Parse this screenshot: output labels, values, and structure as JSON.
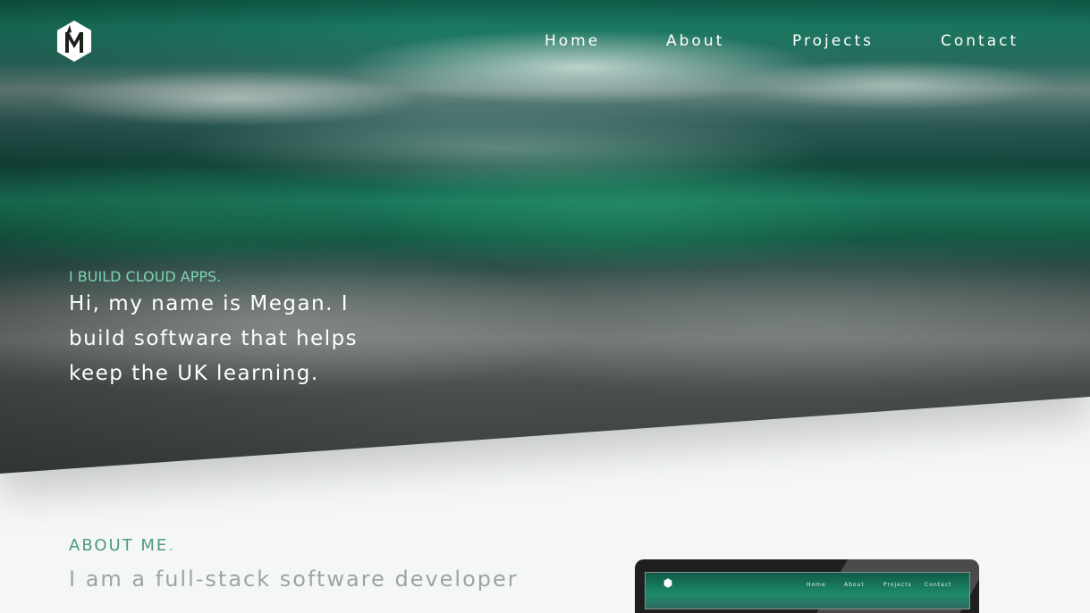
{
  "logo": {
    "icon": "hexagon-m-logo-icon"
  },
  "nav": {
    "items": [
      {
        "label": "Home"
      },
      {
        "label": "About"
      },
      {
        "label": "Projects"
      },
      {
        "label": "Contact"
      }
    ]
  },
  "hero": {
    "tagline": "I BUILD CLOUD APPS.",
    "intro": "Hi, my name is Megan. I build software that helps keep the UK learning."
  },
  "about": {
    "heading": "ABOUT ME",
    "heading_dot": ".",
    "body": "I am a full-stack software developer"
  },
  "laptop_preview": {
    "nav": [
      "Home",
      "About",
      "Projects",
      "Contact"
    ]
  },
  "colors": {
    "accent": "#7cd3b3",
    "heading": "#4f9a7d",
    "body_text": "#9aa6a4",
    "page_background": "#f4f7f6"
  }
}
